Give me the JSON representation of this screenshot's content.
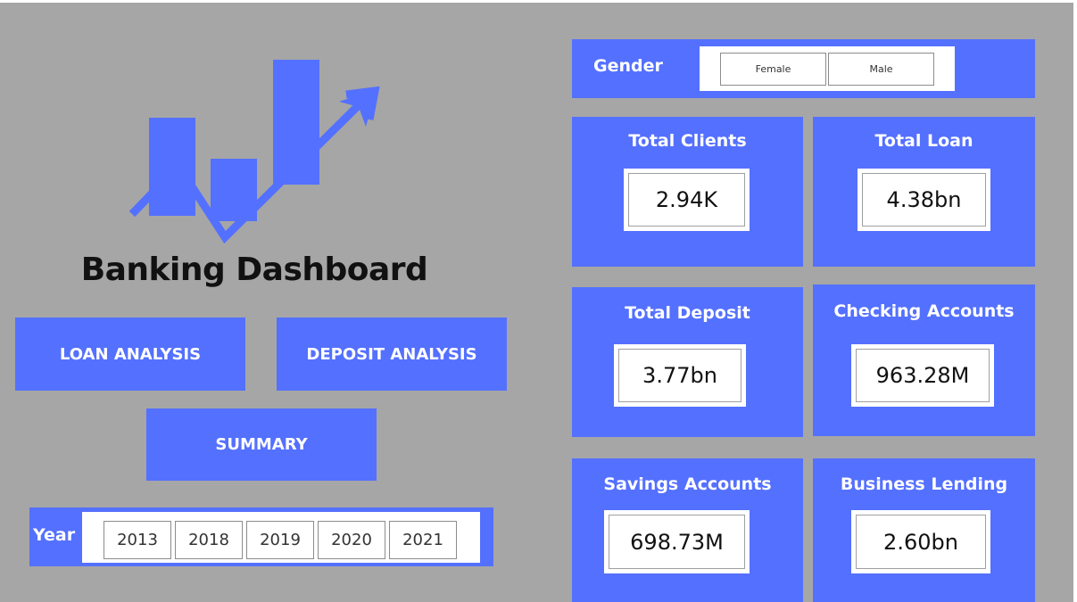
{
  "title": "Banking Dashboard",
  "nav": {
    "loan_analysis": "LOAN ANALYSIS",
    "deposit_analysis": "DEPOSIT ANALYSIS",
    "summary": "SUMMARY"
  },
  "year_filter": {
    "label": "Year",
    "options": [
      "2013",
      "2018",
      "2019",
      "2020",
      "2021"
    ]
  },
  "gender_filter": {
    "label": "Gender",
    "options": [
      "Female",
      "Male"
    ]
  },
  "kpis": [
    {
      "label": "Total Clients",
      "value": "2.94K"
    },
    {
      "label": "Total Loan",
      "value": "4.38bn"
    },
    {
      "label": "Total Deposit",
      "value": "3.77bn"
    },
    {
      "label": "Checking Accounts",
      "value": "963.28M"
    },
    {
      "label": "Savings Accounts",
      "value": "698.73M"
    },
    {
      "label": "Business Lending",
      "value": "2.60bn"
    }
  ],
  "colors": {
    "accent": "#5470ff",
    "background": "#a6a6a6",
    "card_value_bg": "#ffffff"
  },
  "icons": {
    "logo": "bar-chart-growth-arrow-icon"
  }
}
